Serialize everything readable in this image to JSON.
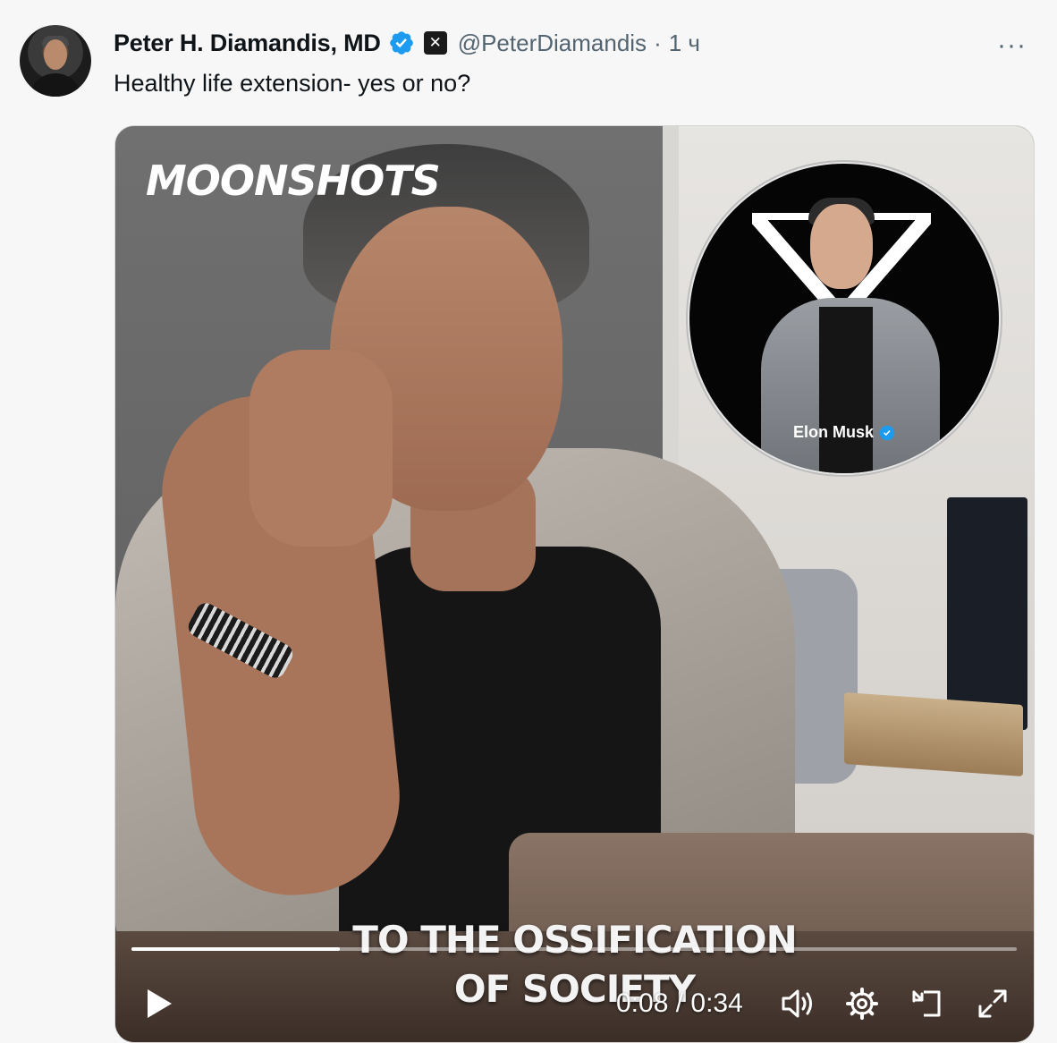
{
  "author": {
    "name": "Peter H. Diamandis, MD",
    "handle": "@PeterDiamandis",
    "separator": "·",
    "time": "1 ч",
    "badge_letter": "✕"
  },
  "tweet": {
    "text": "Healthy life extension- yes or no?"
  },
  "more_label": "···",
  "video": {
    "brand_overlay": "MOONSHOTS",
    "guest_name": "Elon Musk",
    "subtitle_line1": "TO THE OSSIFICATION",
    "subtitle_line2": "OF SOCIETY",
    "timecode": "0:08 / 0:34",
    "progress": 0.235
  },
  "icons": {
    "verified": "verified-badge-icon",
    "x_badge": "x-affiliate-icon",
    "more": "more-icon",
    "play": "play-icon",
    "volume": "volume-icon",
    "settings": "gear-icon",
    "pip": "picture-in-picture-icon",
    "fullscreen": "fullscreen-icon"
  },
  "colors": {
    "verified_blue": "#1d9bf0",
    "text_primary": "#0f1419",
    "text_secondary": "#536471"
  }
}
